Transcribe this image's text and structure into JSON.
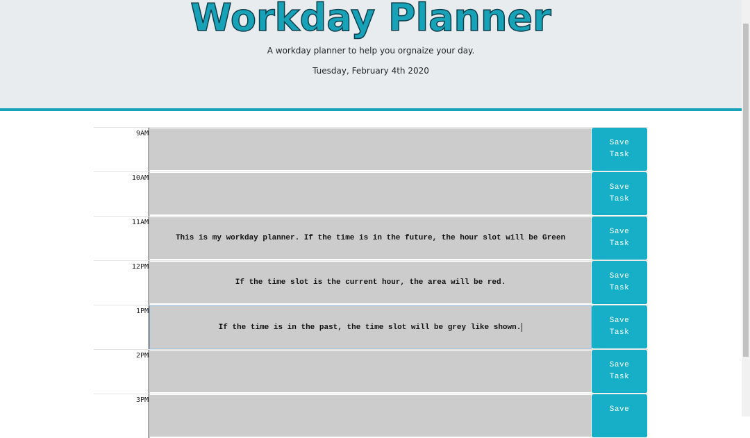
{
  "header": {
    "title": "Workday Planner",
    "subtitle": "A workday planner to help you orgnaize your day.",
    "current_day": "Tuesday, February 4th 2020"
  },
  "rows": [
    {
      "hour": "9AM",
      "text": "",
      "save_label": "Save Task"
    },
    {
      "hour": "10AM",
      "text": "",
      "save_label": "Save Task"
    },
    {
      "hour": "11AM",
      "text": "This is my workday planner. If the time is in the future, the hour slot will be Green",
      "save_label": "Save Task"
    },
    {
      "hour": "12PM",
      "text": "If the time slot is the current hour, the area will be red.",
      "save_label": "Save Task"
    },
    {
      "hour": "1PM",
      "text": "If the time is in the past, the time slot will be grey like shown.",
      "save_label": "Save Task"
    },
    {
      "hour": "2PM",
      "text": "",
      "save_label": "Save Task"
    },
    {
      "hour": "3PM",
      "text": "",
      "save_label": "Save"
    }
  ],
  "colors": {
    "accent": "#17a2b8",
    "past_slot": "#cccccc",
    "header_bg": "#e9ecef"
  }
}
